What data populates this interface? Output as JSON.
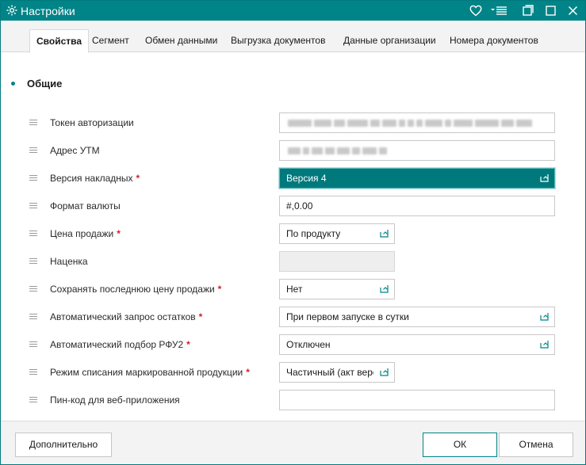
{
  "window": {
    "title": "Настройки",
    "title_bar_bg": "#008487"
  },
  "tabs": [
    {
      "label": "Свойства",
      "active": true
    },
    {
      "label": "Сегмент",
      "active": false
    },
    {
      "label": "Обмен данными",
      "active": false
    },
    {
      "label": "Выгрузка документов",
      "active": false
    },
    {
      "label": "Данные организации",
      "active": false
    },
    {
      "label": "Номера документов",
      "active": false
    }
  ],
  "section": {
    "title": "Общие"
  },
  "fields": [
    {
      "label": "Токен авторизации",
      "required": false,
      "type": "text",
      "value": "",
      "blurred": true
    },
    {
      "label": "Адрес УТМ",
      "required": false,
      "type": "text",
      "value": "",
      "blurred": true
    },
    {
      "label": "Версия накладных",
      "required": true,
      "type": "select",
      "value": "Версия 4",
      "selected": true
    },
    {
      "label": "Формат валюты",
      "required": false,
      "type": "text",
      "value": "#,0.00"
    },
    {
      "label": "Цена продажи",
      "required": true,
      "type": "select",
      "value": "По продукту"
    },
    {
      "label": "Наценка",
      "required": false,
      "type": "text",
      "value": "",
      "disabled": true
    },
    {
      "label": "Сохранять последнюю цену продажи",
      "required": true,
      "type": "select",
      "value": "Нет"
    },
    {
      "label": "Автоматический запрос остатков",
      "required": true,
      "type": "select",
      "value": "При первом запуске в сутки"
    },
    {
      "label": "Автоматический подбор РФУ2",
      "required": true,
      "type": "select",
      "value": "Отключен"
    },
    {
      "label": "Режим списания маркированной продукции",
      "required": true,
      "type": "select",
      "value": "Частичный (акт верс"
    },
    {
      "label": "Пин-код для веб-приложения",
      "required": false,
      "type": "text",
      "value": ""
    }
  ],
  "required_marker": "*",
  "footer": {
    "more_label": "Дополнительно",
    "ok_label": "ОК",
    "cancel_label": "Отмена"
  },
  "colors": {
    "accent": "#008487",
    "selected_field": "#00797c",
    "required": "#d01f2c"
  },
  "icons": {
    "app": "gear-icon",
    "favorite": "heart-icon",
    "menu": "menu-list-icon",
    "restore": "restore-window-icon",
    "maximize": "maximize-icon",
    "close": "close-icon",
    "dropdown": "dropdown-icon",
    "drag": "drag-handle-icon"
  }
}
